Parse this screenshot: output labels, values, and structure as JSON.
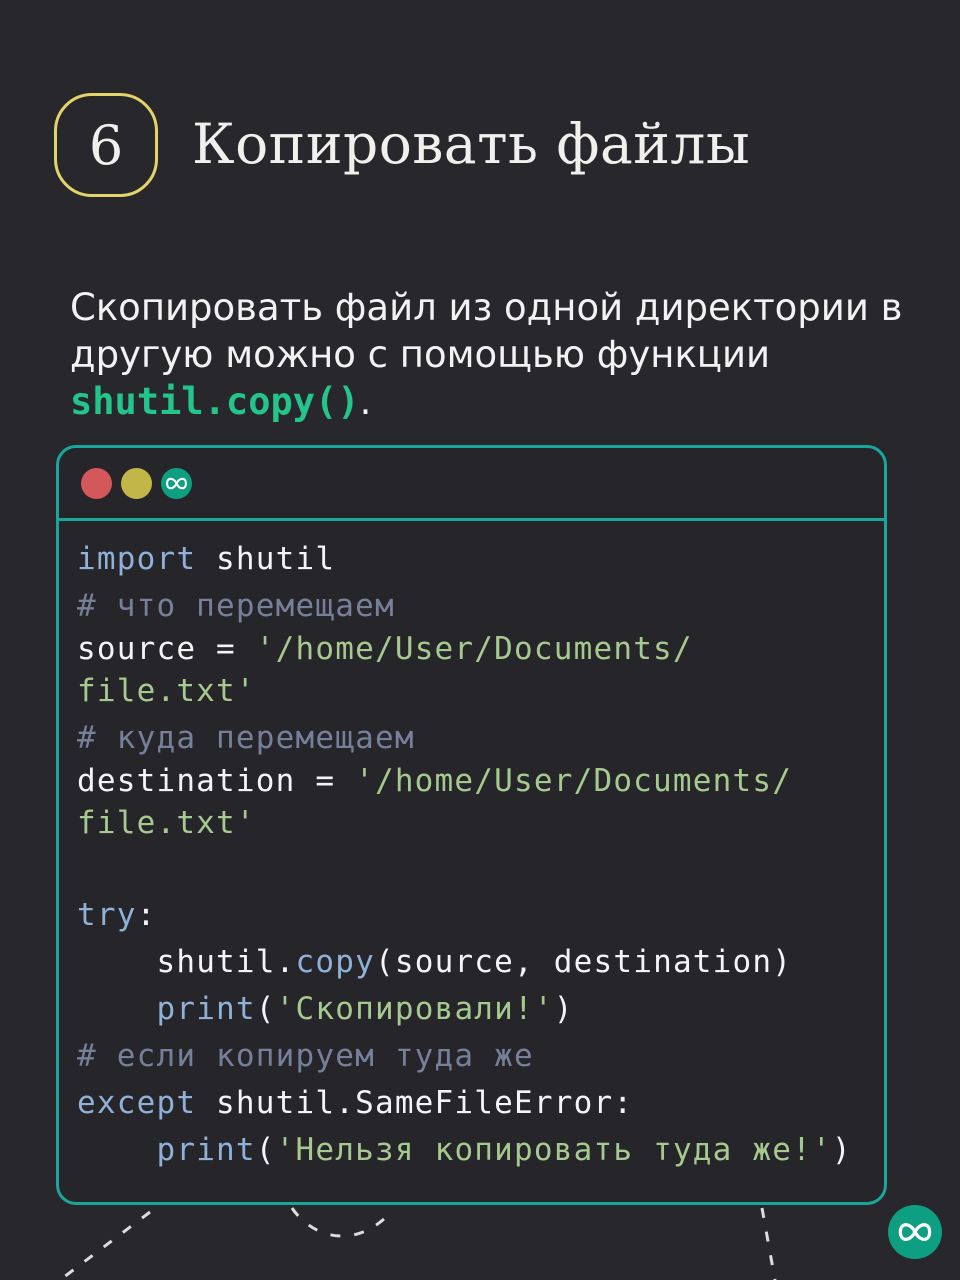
{
  "step_number": "6",
  "title": "Копировать файлы",
  "intro": {
    "text_before": "Скопировать файл из одной директории в другую можно с помощью функции ",
    "function_name": "shutil.copy()",
    "text_after": "."
  },
  "window": {
    "controls": [
      "close",
      "minimize",
      "logo"
    ]
  },
  "code": {
    "l1_kw": "import",
    "l1_rest": " shutil",
    "l2_comment": "# что перемещаем",
    "l3_code": "source = ",
    "l3_str": "'/home/User/Documents/",
    "l4_str": "file.txt'",
    "l5_comment": "# куда перемещаем",
    "l6_code": "destination = ",
    "l6_str": "'/home/User/Documents/",
    "l7_str": "file.txt'",
    "l9_kw": "try",
    "l9_colon": ":",
    "l10_indent": "    ",
    "l10_obj": "shutil.",
    "l10_fn": "copy",
    "l10_args": "(source, destination)",
    "l11_indent": "    ",
    "l11_fn": "print",
    "l11_open": "(",
    "l11_str": "'Скопировали!'",
    "l11_close": ")",
    "l12_comment": "# если копируем туда же",
    "l13_kw": "except",
    "l13_rest": " shutil.SameFileError:",
    "l14_indent": "    ",
    "l14_fn": "print",
    "l14_open": "(",
    "l14_str": "'Нельзя копировать туда же!'",
    "l14_close": ")"
  },
  "colors": {
    "background": "#27272c",
    "accent_teal": "#1aa69a",
    "badge_yellow": "#e2d46a",
    "function_green": "#24c58a",
    "keyword": "#8fb1d7",
    "comment": "#76809a",
    "string": "#a6c98f"
  },
  "icons": {
    "window_logo": "infinity-loop-icon",
    "corner_logo": "infinity-loop-icon"
  }
}
